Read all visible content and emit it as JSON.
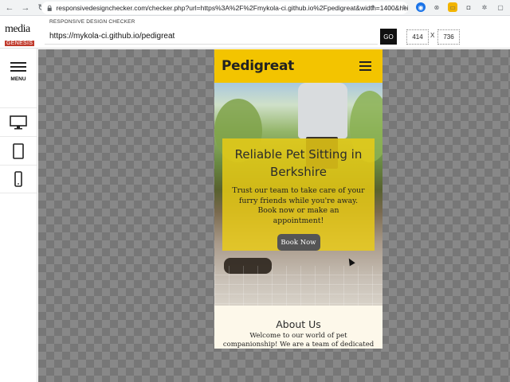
{
  "browser": {
    "url": "responsivedesignchecker.com/checker.php?url=https%3A%2F%2Fmykola-ci.github.io%2Fpedigreat&width=1400&height=7...",
    "back_icon": "arrow-left-icon",
    "forward_icon": "arrow-right-icon",
    "reload_icon": "reload-icon"
  },
  "checker": {
    "brand_line1": "media",
    "brand_line2": "GENESIS",
    "label": "RESPONSIVE DESIGN CHECKER",
    "url_value": "https://mykola-ci.github.io/pedigreat",
    "go_label": "GO",
    "width_value": "414",
    "height_value": "736",
    "dim_separator": "X",
    "menu_label": "MENU",
    "devices": [
      "desktop-icon",
      "tablet-icon",
      "phone-icon"
    ]
  },
  "site": {
    "logo": "Pedigreat",
    "hero_title": "Reliable Pet Sitting in Berkshire",
    "hero_text": "Trust our team to take care of your furry friends while you're away. Book now or make an appointment!",
    "cta_label": "Book Now",
    "about_title": "About Us",
    "about_text": "Welcome to our world of pet companionship! We are a team of dedicated dog lovers, committed to",
    "header_color": "#f3c400",
    "card_color": "#ebcd14",
    "button_color": "#555555"
  }
}
